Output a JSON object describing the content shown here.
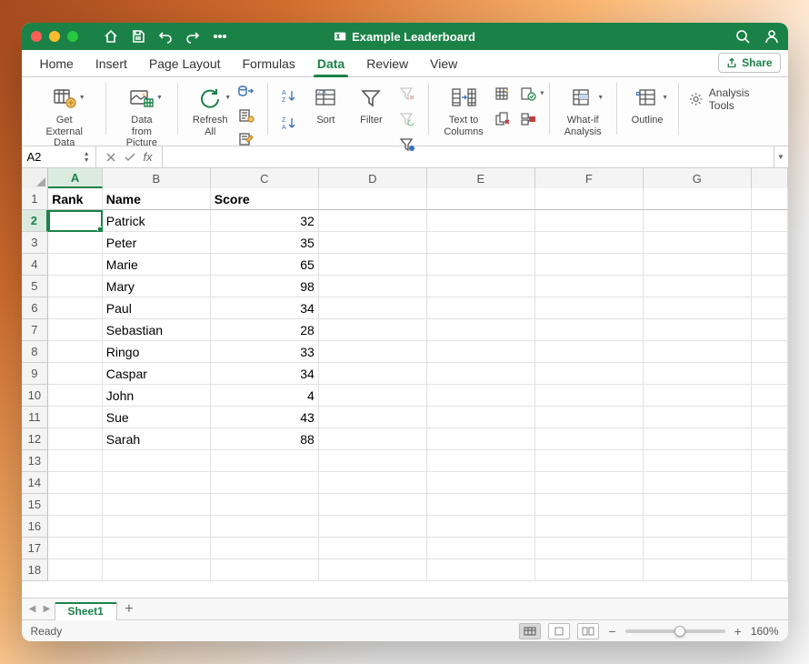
{
  "titlebar": {
    "doc_title": "Example Leaderboard"
  },
  "tabs": {
    "items": [
      "Home",
      "Insert",
      "Page Layout",
      "Formulas",
      "Data",
      "Review",
      "View"
    ],
    "active_index": 4,
    "share_label": "Share"
  },
  "ribbon": {
    "get_external_data": "Get External\nData",
    "data_from_picture": "Data from\nPicture",
    "refresh_all": "Refresh\nAll",
    "sort": "Sort",
    "filter": "Filter",
    "text_to_columns": "Text to\nColumns",
    "what_if": "What-if\nAnalysis",
    "outline": "Outline",
    "analysis_tools": "Analysis Tools"
  },
  "namebox": {
    "value": "A2"
  },
  "formula": {
    "value": ""
  },
  "columns": [
    "A",
    "B",
    "C",
    "D",
    "E",
    "F",
    "G"
  ],
  "selected_col_index": 0,
  "selected_row_index": 1,
  "grid": {
    "headers": {
      "A": "Rank",
      "B": "Name",
      "C": "Score"
    },
    "rows": [
      {
        "B": "Patrick",
        "C": 32
      },
      {
        "B": "Peter",
        "C": 35
      },
      {
        "B": "Marie",
        "C": 65
      },
      {
        "B": "Mary",
        "C": 98
      },
      {
        "B": "Paul",
        "C": 34
      },
      {
        "B": "Sebastian",
        "C": 28
      },
      {
        "B": "Ringo",
        "C": 33
      },
      {
        "B": "Caspar",
        "C": 34
      },
      {
        "B": "John",
        "C": 4
      },
      {
        "B": "Sue",
        "C": 43
      },
      {
        "B": "Sarah",
        "C": 88
      }
    ],
    "total_display_rows": 18
  },
  "sheets": {
    "items": [
      "Sheet1"
    ],
    "active_index": 0
  },
  "status": {
    "text": "Ready",
    "zoom": "160%"
  }
}
